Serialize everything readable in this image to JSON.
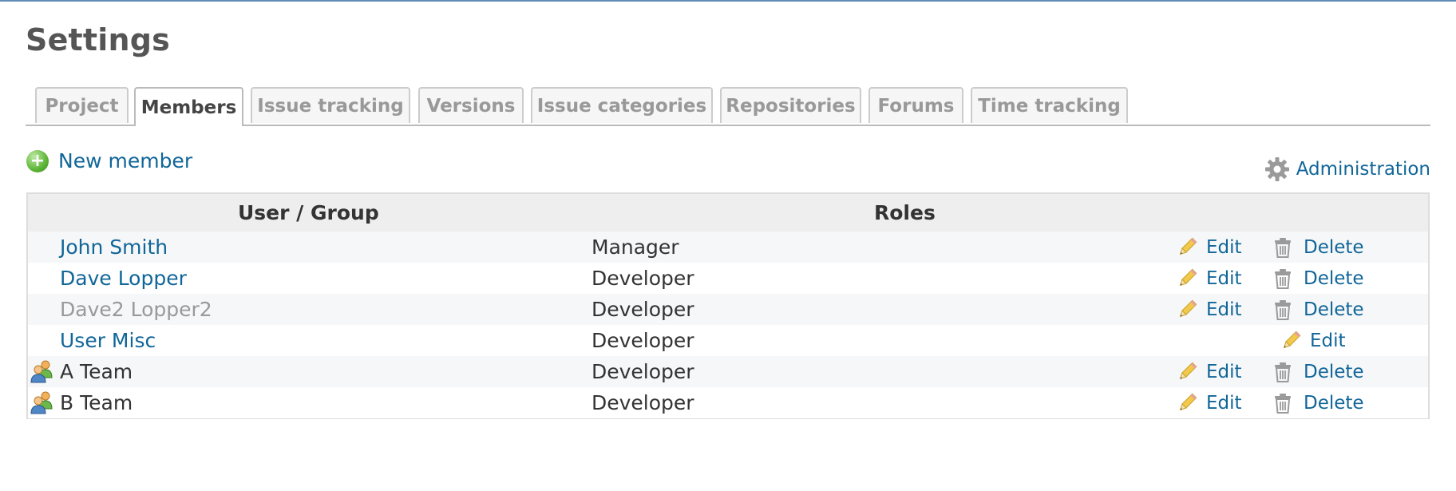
{
  "page": {
    "title": "Settings"
  },
  "tabs": [
    {
      "label": "Project",
      "active": false
    },
    {
      "label": "Members",
      "active": true
    },
    {
      "label": "Issue tracking",
      "active": false
    },
    {
      "label": "Versions",
      "active": false
    },
    {
      "label": "Issue categories",
      "active": false
    },
    {
      "label": "Repositories",
      "active": false
    },
    {
      "label": "Forums",
      "active": false
    },
    {
      "label": "Time tracking",
      "active": false
    }
  ],
  "actions": {
    "new_member": "New member",
    "administration": "Administration"
  },
  "table": {
    "headers": {
      "user_group": "User / Group",
      "roles": "Roles"
    },
    "edit_label": "Edit",
    "delete_label": "Delete",
    "rows": [
      {
        "name": "John Smith",
        "role": "Manager",
        "kind": "user",
        "deletable": true
      },
      {
        "name": "Dave Lopper",
        "role": "Developer",
        "kind": "user",
        "deletable": true
      },
      {
        "name": "Dave2 Lopper2",
        "role": "Developer",
        "kind": "locked-user",
        "deletable": true
      },
      {
        "name": "User Misc",
        "role": "Developer",
        "kind": "user",
        "deletable": false
      },
      {
        "name": "A Team",
        "role": "Developer",
        "kind": "group",
        "deletable": true
      },
      {
        "name": "B Team",
        "role": "Developer",
        "kind": "group",
        "deletable": true
      }
    ]
  },
  "colors": {
    "link": "#116699",
    "muted": "#999999",
    "accent": "#628db6"
  },
  "icons": {
    "add": "add-icon",
    "admin": "gear-icon",
    "edit": "pencil-icon",
    "delete": "trash-icon",
    "group": "group-icon"
  }
}
